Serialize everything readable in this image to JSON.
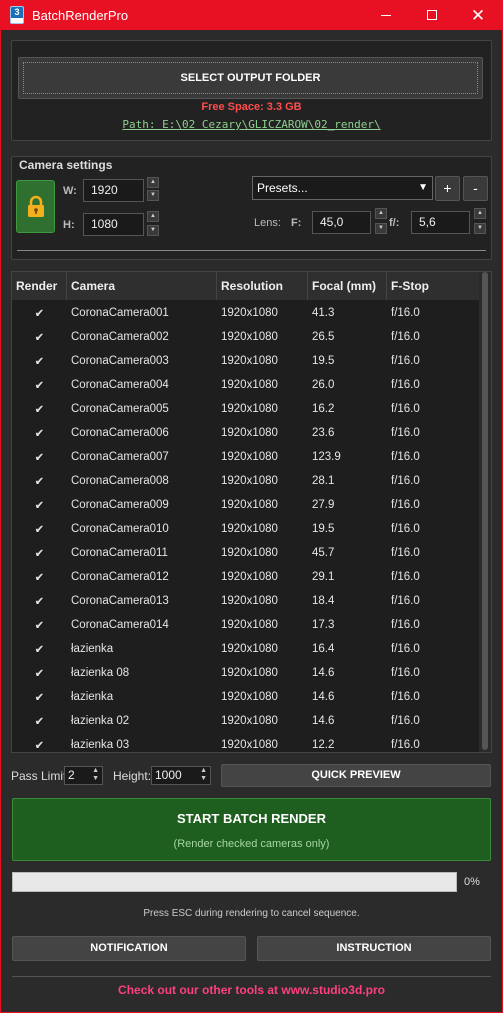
{
  "window": {
    "title": "BatchRenderPro",
    "icon_text": "3"
  },
  "output": {
    "select_button": "SELECT OUTPUT FOLDER",
    "free_space": "Free Space: 3.3 GB",
    "path": "Path: E:\\02 Cezary\\GLICZAROW\\02_render\\"
  },
  "camera_settings": {
    "title": "Camera settings",
    "width_label": "W:",
    "width": "1920",
    "height_label": "H:",
    "height": "1080",
    "presets": "Presets...",
    "add_label": "+",
    "remove_label": "-",
    "lens_label": "Lens:",
    "focal_label": "F:",
    "focal": "45,0",
    "fstop_label": "f/:",
    "fstop": "5,6"
  },
  "table": {
    "headers": [
      "Render",
      "Camera",
      "Resolution",
      "Focal (mm)",
      "F-Stop"
    ],
    "rows": [
      [
        "✔",
        "CoronaCamera001",
        "1920x1080",
        "41.3",
        "f/16.0"
      ],
      [
        "✔",
        "CoronaCamera002",
        "1920x1080",
        "26.5",
        "f/16.0"
      ],
      [
        "✔",
        "CoronaCamera003",
        "1920x1080",
        "19.5",
        "f/16.0"
      ],
      [
        "✔",
        "CoronaCamera004",
        "1920x1080",
        "26.0",
        "f/16.0"
      ],
      [
        "✔",
        "CoronaCamera005",
        "1920x1080",
        "16.2",
        "f/16.0"
      ],
      [
        "✔",
        "CoronaCamera006",
        "1920x1080",
        "23.6",
        "f/16.0"
      ],
      [
        "✔",
        "CoronaCamera007",
        "1920x1080",
        "123.9",
        "f/16.0"
      ],
      [
        "✔",
        "CoronaCamera008",
        "1920x1080",
        "28.1",
        "f/16.0"
      ],
      [
        "✔",
        "CoronaCamera009",
        "1920x1080",
        "27.9",
        "f/16.0"
      ],
      [
        "✔",
        "CoronaCamera010",
        "1920x1080",
        "19.5",
        "f/16.0"
      ],
      [
        "✔",
        "CoronaCamera011",
        "1920x1080",
        "45.7",
        "f/16.0"
      ],
      [
        "✔",
        "CoronaCamera012",
        "1920x1080",
        "29.1",
        "f/16.0"
      ],
      [
        "✔",
        "CoronaCamera013",
        "1920x1080",
        "18.4",
        "f/16.0"
      ],
      [
        "✔",
        "CoronaCamera014",
        "1920x1080",
        "17.3",
        "f/16.0"
      ],
      [
        "✔",
        "łazienka",
        "1920x1080",
        "16.4",
        "f/16.0"
      ],
      [
        "✔",
        "łazienka 08",
        "1920x1080",
        "14.6",
        "f/16.0"
      ],
      [
        "✔",
        "łazienka",
        "1920x1080",
        "14.6",
        "f/16.0"
      ],
      [
        "✔",
        "łazienka 02",
        "1920x1080",
        "14.6",
        "f/16.0"
      ],
      [
        "✔",
        "łazienka 03",
        "1920x1080",
        "12.2",
        "f/16.0"
      ]
    ]
  },
  "preview": {
    "pass_limit_label": "Pass Limit:",
    "pass_limit": "2",
    "height_label": "Height:",
    "height": "1000",
    "quick_preview": "QUICK PREVIEW"
  },
  "render": {
    "start_label": "START BATCH RENDER",
    "start_sub": "(Render checked cameras only)",
    "progress_percent": 0,
    "progress_text": "0%",
    "esc_note": "Press ESC during rendering to cancel sequence."
  },
  "footer": {
    "notification": "NOTIFICATION",
    "instruction": "INSTRUCTION",
    "promo": "Check out our other tools at www.studio3d.pro"
  },
  "colors": {
    "titlebar": "#e81123",
    "accent_green": "#1e5e1e",
    "promo": "#ff3f80",
    "free_space": "#ff4d4d"
  }
}
